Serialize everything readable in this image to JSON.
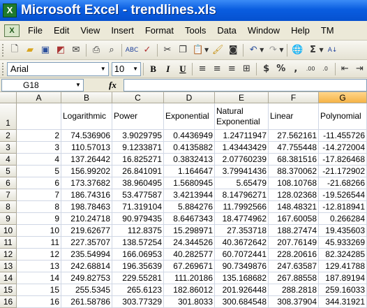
{
  "window": {
    "title": "Microsoft Excel - trendlines.xls",
    "app_icon": "X"
  },
  "menu": [
    "File",
    "Edit",
    "View",
    "Insert",
    "Format",
    "Tools",
    "Data",
    "Window",
    "Help",
    "TM"
  ],
  "format_toolbar": {
    "font": "Arial",
    "size": "10",
    "bold": "B",
    "italic": "I",
    "underline": "U"
  },
  "formula_bar": {
    "cell_ref": "G18",
    "fx": "fx",
    "value": ""
  },
  "columns": [
    "A",
    "B",
    "C",
    "D",
    "E",
    "F",
    "G"
  ],
  "selected_column": "G",
  "header_row": [
    "",
    "Logarithmic",
    "Power",
    "Exponential",
    "Natural Exponential",
    "Linear",
    "Polynomial"
  ],
  "rows": [
    [
      "2",
      "74.536906",
      "3.9029795",
      "0.4436949",
      "1.24711947",
      "27.562161",
      "-11.455726"
    ],
    [
      "3",
      "110.57013",
      "9.1233871",
      "0.4135882",
      "1.43443429",
      "47.755448",
      "-14.272004"
    ],
    [
      "4",
      "137.26442",
      "16.825271",
      "0.3832413",
      "2.07760239",
      "68.381516",
      "-17.826468"
    ],
    [
      "5",
      "156.99202",
      "26.841091",
      "1.164647",
      "3.79941436",
      "88.370062",
      "-21.172902"
    ],
    [
      "6",
      "173.37682",
      "38.960495",
      "1.5680945",
      "5.65479",
      "108.10768",
      "-21.68266"
    ],
    [
      "7",
      "186.74316",
      "53.477587",
      "3.4213944",
      "8.14796271",
      "128.02368",
      "-19.526544"
    ],
    [
      "8",
      "198.78463",
      "71.319104",
      "5.884276",
      "11.7992566",
      "148.48321",
      "-12.818941"
    ],
    [
      "9",
      "210.24718",
      "90.979435",
      "8.6467343",
      "18.4774962",
      "167.60058",
      "0.266284"
    ],
    [
      "10",
      "219.62677",
      "112.8375",
      "15.298971",
      "27.353718",
      "188.27474",
      "19.435603"
    ],
    [
      "11",
      "227.35707",
      "138.57254",
      "24.344526",
      "40.3672642",
      "207.76149",
      "45.933269"
    ],
    [
      "12",
      "235.54994",
      "166.06953",
      "40.282577",
      "60.7072441",
      "228.20616",
      "82.324285"
    ],
    [
      "13",
      "242.68814",
      "196.35639",
      "67.269671",
      "90.7349876",
      "247.63587",
      "129.41788"
    ],
    [
      "14",
      "249.82753",
      "229.55281",
      "111.20186",
      "135.168682",
      "267.88558",
      "187.89194"
    ],
    [
      "15",
      "255.5345",
      "265.6123",
      "182.86012",
      "201.926448",
      "288.2818",
      "259.16033"
    ],
    [
      "16",
      "261.58786",
      "303.77329",
      "301.8033",
      "300.684548",
      "308.37904",
      "344.31921"
    ]
  ]
}
